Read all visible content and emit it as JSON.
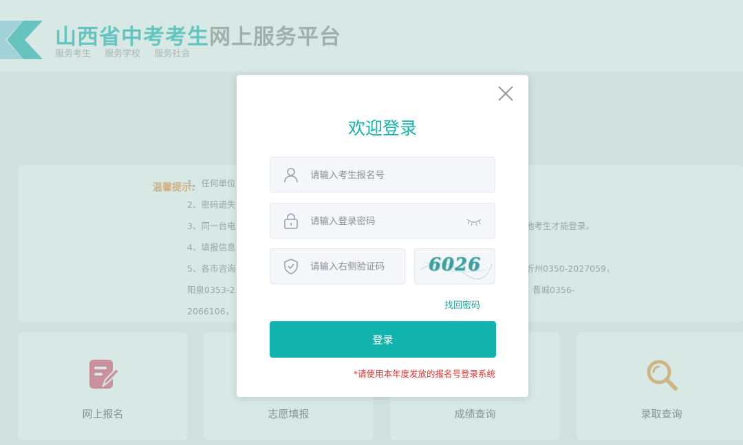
{
  "site": {
    "title_part1": "山西省中考考生",
    "title_part2": "网上服务平台",
    "subtitle_items": [
      "服务考生",
      "服务学校",
      "服务社会"
    ],
    "brand_color": "#12b8b2"
  },
  "notice": {
    "title": "温馨提示:",
    "lines": [
      "1、任何单位",
      "2、密码遗失",
      "3、同一台电",
      "他考生才能登录。",
      "4、填报信息",
      "5、各市咨询",
      "忻州0350-2027059，",
      "阳泉0353-2",
      "晋城0356-",
      "2066106，"
    ]
  },
  "services": [
    {
      "label": "网上报名",
      "icon": "edit-form-icon"
    },
    {
      "label": "志愿填报",
      "icon": "volunteer-icon"
    },
    {
      "label": "成绩查询",
      "icon": "score-icon"
    },
    {
      "label": "录取查询",
      "icon": "search-icon"
    }
  ],
  "login": {
    "title": "欢迎登录",
    "username_placeholder": "请输入考生报名号",
    "password_placeholder": "请输入登录密码",
    "captcha_placeholder": "请输入右侧验证码",
    "captcha_code": "6026",
    "forgot_label": "找回密码",
    "submit_label": "登录",
    "note": "*请使用本年度发放的报名号登录系统",
    "accent_color": "#12b3ad",
    "note_color": "#e8322f"
  }
}
